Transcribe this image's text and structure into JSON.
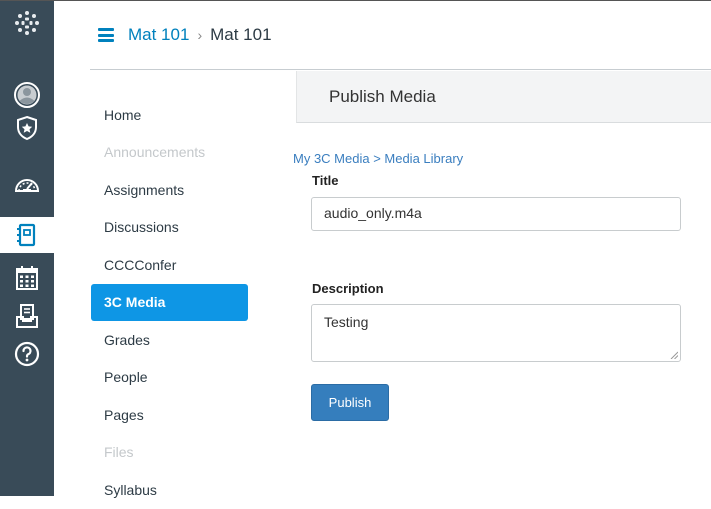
{
  "global_nav": {
    "items": [
      {
        "name": "logo-icon"
      },
      {
        "name": "account-icon"
      },
      {
        "name": "admin-icon"
      },
      {
        "name": "dashboard-icon"
      },
      {
        "name": "courses-icon",
        "active": true
      },
      {
        "name": "calendar-icon"
      },
      {
        "name": "inbox-icon"
      },
      {
        "name": "help-icon"
      }
    ],
    "bg_color": "#394b58"
  },
  "header": {
    "course_link": "Mat 101",
    "separator": "›",
    "current": "Mat 101"
  },
  "course_nav": {
    "items": [
      {
        "label": "Home",
        "state": "normal"
      },
      {
        "label": "Announcements",
        "state": "disabled"
      },
      {
        "label": "Assignments",
        "state": "normal"
      },
      {
        "label": "Discussions",
        "state": "normal"
      },
      {
        "label": "CCCConfer",
        "state": "normal"
      },
      {
        "label": "3C Media",
        "state": "active"
      },
      {
        "label": "Grades",
        "state": "normal"
      },
      {
        "label": "People",
        "state": "normal"
      },
      {
        "label": "Pages",
        "state": "normal"
      },
      {
        "label": "Files",
        "state": "disabled"
      },
      {
        "label": "Syllabus",
        "state": "normal"
      }
    ],
    "active_color": "#0e96e5"
  },
  "main": {
    "panel_title": "Publish Media",
    "breadcrumb": "My 3C Media > Media Library",
    "title_label": "Title",
    "title_value": "audio_only.m4a",
    "description_label": "Description",
    "description_value": "Testing",
    "publish_label": "Publish",
    "button_color": "#357ebd"
  }
}
